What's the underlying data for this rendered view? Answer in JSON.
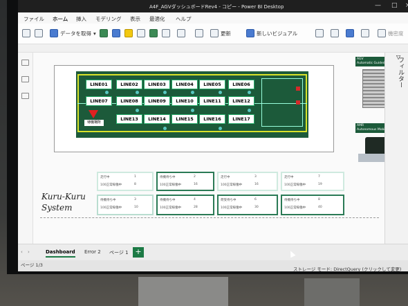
{
  "window": {
    "title": "A4F_AGVダッシュボードRev4 - コピー - Power BI Desktop",
    "icons": [
      "minimize-icon",
      "maximize-icon",
      "close-icon"
    ]
  },
  "menu_tabs": [
    "ファイル",
    "ホーム",
    "挿入",
    "モデリング",
    "表示",
    "最適化",
    "ヘルプ"
  ],
  "active_menu_tab": "ホーム",
  "toolbar": {
    "get_data": "データを取得",
    "refresh": "更新",
    "new_visual": "新しいビジュアル",
    "right_label": "機密度"
  },
  "filter_pane_label": "フィルター",
  "floorplan": {
    "lines_row1": [
      "LINE01",
      "LINE02",
      "LINE03",
      "LINE04",
      "LINE05",
      "LINE06"
    ],
    "lines_row2": [
      "LINE07",
      "LINE08",
      "LINE09",
      "LINE10",
      "LINE11",
      "LINE12"
    ],
    "lines_row3": [
      "LINE13",
      "LINE14",
      "LINE15",
      "LINE16",
      "LINE17"
    ],
    "standby": "待機場所"
  },
  "legend": {
    "agv_title": "AGV",
    "agv_sub": "Automatic Guided Vehicle",
    "amr_title": "AMR",
    "amr_sub": "Autonomous Mobile Robot"
  },
  "side_title": [
    "Kuru-Kuru",
    "System"
  ],
  "cards_row1": [
    {
      "h1": "走行中",
      "v1": "1",
      "h2": "100正常稼働中",
      "v2": "8"
    },
    {
      "h1": "待機待ち中",
      "v1": "2",
      "h2": "100正常稼働中",
      "v2": "16"
    },
    {
      "h1": "走行中",
      "v1": "3",
      "h2": "100正常稼働中",
      "v2": "16"
    },
    {
      "h1": "走行中",
      "v1": "7",
      "h2": "100正常稼働中",
      "v2": "19"
    }
  ],
  "cards_row2": [
    {
      "h1": "待機待ち中",
      "v1": "3",
      "h2": "100正常稼働中",
      "v2": "10"
    },
    {
      "h1": "待機待ち中",
      "v1": "4",
      "h2": "100正常稼働中",
      "v2": "28"
    },
    {
      "h1": "荷受待ち中",
      "v1": "6",
      "h2": "100正常稼働中",
      "v2": "30"
    },
    {
      "h1": "待機待ち中",
      "v1": "8",
      "h2": "100正常稼働中",
      "v2": "40"
    }
  ],
  "page_tabs": [
    "Dashboard",
    "Error 2",
    "ページ 1"
  ],
  "active_page": "Dashboard",
  "add_page": "+",
  "status": {
    "page": "ページ 1/3",
    "storage": "ストレージ モード: DirectQuery (クリックして変更)"
  }
}
